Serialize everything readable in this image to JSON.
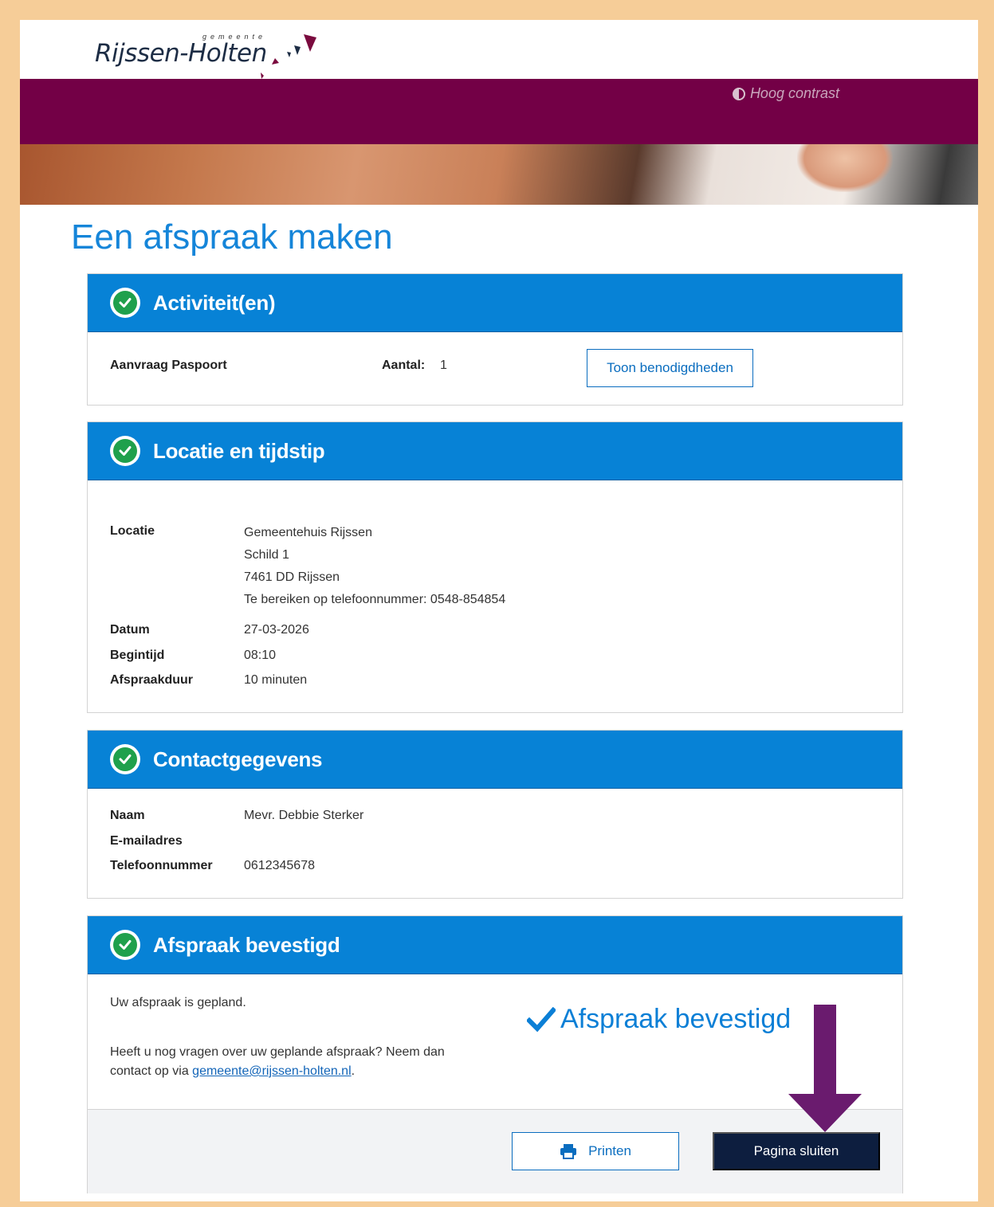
{
  "header": {
    "logo_small": "gemeente",
    "logo_main": "Rijssen-Holten",
    "contrast_label": "Hoog contrast"
  },
  "page": {
    "title": "Een afspraak maken"
  },
  "activities": {
    "title": "Activiteit(en)",
    "item": "Aanvraag Paspoort",
    "count_label": "Aantal:",
    "count_value": "1",
    "requirements_button": "Toon benodigdheden"
  },
  "location": {
    "title": "Locatie en tijdstip",
    "location_label": "Locatie",
    "location_lines": [
      "Gemeentehuis Rijssen",
      "Schild 1",
      "7461 DD Rijssen",
      "Te bereiken op telefoonnummer: 0548-854854"
    ],
    "date_label": "Datum",
    "date_value": "27-03-2026",
    "start_label": "Begintijd",
    "start_value": "08:10",
    "duration_label": "Afspraakduur",
    "duration_value": "10 minuten"
  },
  "contact": {
    "title": "Contactgegevens",
    "name_label": "Naam",
    "name_value": "Mevr. Debbie Sterker",
    "email_label": "E-mailadres",
    "phone_label": "Telefoonnummer",
    "phone_value": "0612345678"
  },
  "confirmation": {
    "title": "Afspraak bevestigd",
    "planned_text": "Uw afspraak is gepland.",
    "questions_line1": "Heeft u nog vragen over uw geplande afspraak? Neem dan",
    "questions_line2_prefix": "contact op via ",
    "email_link": "gemeente@rijssen-holten.nl",
    "questions_line2_suffix": ".",
    "confirmed_badge": "Afspraak bevestigd",
    "print_button": "Printen",
    "close_button": "Pagina sluiten"
  },
  "colors": {
    "brand_purple": "#730046",
    "section_blue": "#0782d6",
    "title_blue": "#1585d9",
    "check_green": "#1fa04c",
    "dark_button": "#0d1e3f",
    "arrow_purple": "#6a1b6e"
  }
}
